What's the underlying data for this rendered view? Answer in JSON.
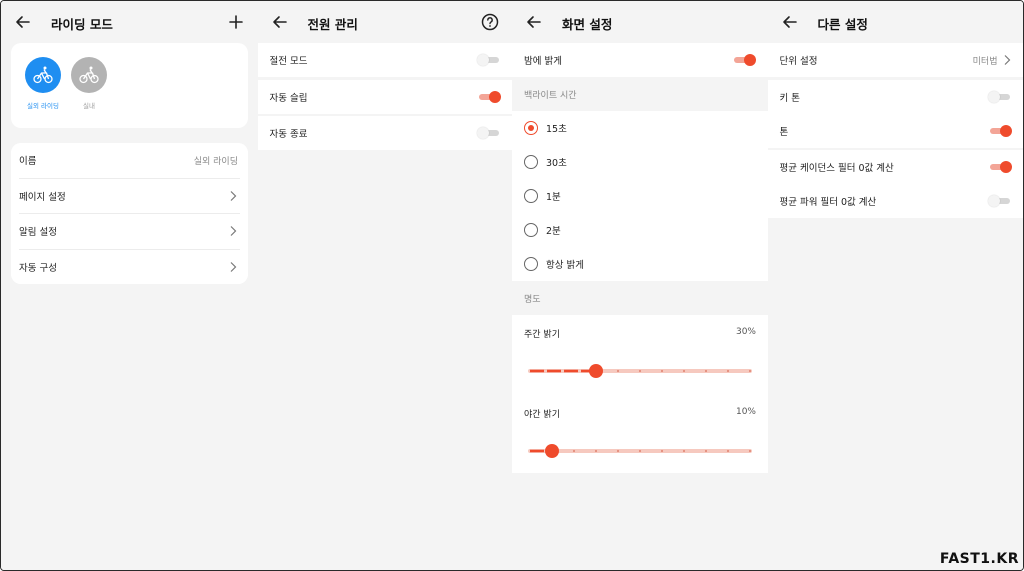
{
  "riding_mode": {
    "title": "라이딩 모드",
    "modes": [
      {
        "label": "실외 라이딩",
        "icon": "bike-icon",
        "active": true
      },
      {
        "label": "실내",
        "icon": "bike-icon",
        "active": false
      }
    ],
    "name_label": "이름",
    "name_value": "실외 라이딩",
    "items": [
      "페이지 설정",
      "알림 설정",
      "자동 구성"
    ]
  },
  "power": {
    "title": "전원 관리",
    "rows": [
      {
        "label": "절전 모드",
        "on": false
      },
      {
        "label": "자동 슬립",
        "on": true
      },
      {
        "label": "자동 종료",
        "on": false
      }
    ]
  },
  "display": {
    "title": "화면 설정",
    "night_bright_label": "밤에 밝게",
    "night_bright_on": true,
    "backlight_section": "백라이트 시간",
    "backlight_options": [
      "15초",
      "30초",
      "1분",
      "2분",
      "항상 밝게"
    ],
    "backlight_selected": 0,
    "brightness_section": "명도",
    "day": {
      "label": "주간 밝기",
      "percent_text": "30%",
      "value": 0.3
    },
    "night": {
      "label": "야간 밝기",
      "percent_text": "10%",
      "value": 0.1
    }
  },
  "other": {
    "title": "다른 설정",
    "unit_label": "단위 설정",
    "unit_value": "미터법",
    "rows": [
      {
        "label": "키 톤",
        "on": false
      },
      {
        "label": "톤",
        "on": true
      },
      {
        "label": "평균 케이던스 필터 0값 계산",
        "on": true
      },
      {
        "label": "평균 파워 필터 0값 계산",
        "on": false
      }
    ]
  },
  "colors": {
    "accent": "#ef4b2c",
    "blue": "#1f8ef1",
    "grey_mode": "#b3b3b3",
    "panel_bg": "#f4f4f4"
  },
  "watermark": "FAST1.KR"
}
